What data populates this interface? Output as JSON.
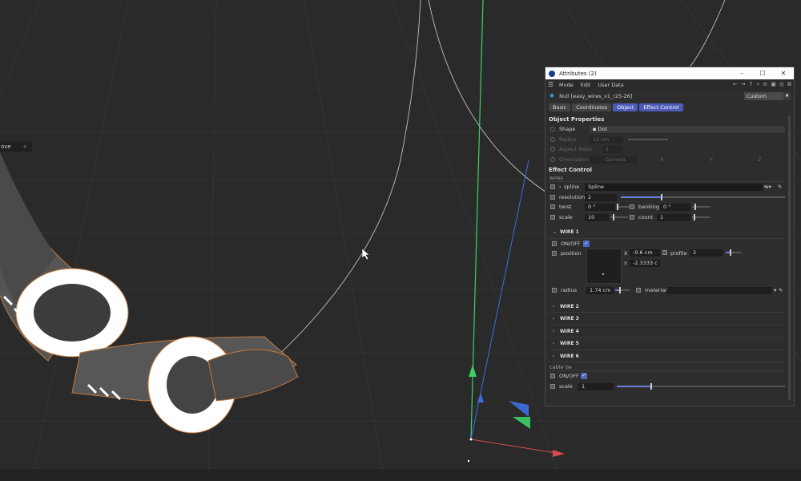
{
  "viewport": {
    "tab_label": "ove",
    "tab_plus": "+"
  },
  "window": {
    "title": "Attributes (2)",
    "controls": {
      "minimize": "–",
      "maximize": "☐",
      "close": "✕"
    }
  },
  "menu": {
    "items": [
      "Mode",
      "Edit",
      "User Data"
    ]
  },
  "object": {
    "name": "Null [easy_wires_v1_r25-26]",
    "mode": "Custom"
  },
  "tabs": [
    {
      "label": "Basic",
      "active": false
    },
    {
      "label": "Coordinates",
      "active": false
    },
    {
      "label": "Object",
      "active": true
    },
    {
      "label": "Effect Control",
      "active": true
    }
  ],
  "object_props": {
    "title": "Object Properties",
    "shape_label": "Shape",
    "shape_value": "Dot",
    "radius_label": "Radius",
    "radius_value": "10 cm",
    "aspect_label": "Aspect Ratio",
    "aspect_value": "1",
    "orientation_label": "Orientation",
    "orientation_value": "Camera",
    "axes": [
      "X",
      "Y",
      "Z"
    ]
  },
  "effect": {
    "title": "Effect Control",
    "group": "wires",
    "spline_label": "spline",
    "spline_value": "Spline",
    "resolution_label": "resolution",
    "resolution_value": "2",
    "twist_label": "twist",
    "twist_value": "0 °",
    "banking_label": "banking",
    "banking_value": "0 °",
    "scale_label": "scale",
    "scale_value": "10",
    "count_label": "count",
    "count_value": "1"
  },
  "wire1": {
    "title": "WIRE 1",
    "onoff_label": "ON/OFF",
    "position_label": "position",
    "x_label": "X",
    "x_value": "-0.6 cm",
    "y_label": "Y",
    "y_value": "-2.3333 c",
    "profile_label": "profile",
    "profile_value": "2",
    "radius_label": "radius",
    "radius_value": "1.74 cm",
    "material_label": "material",
    "material_value": ""
  },
  "wires_collapsed": [
    "WIRE 2",
    "WIRE 3",
    "WIRE 4",
    "WIRE 5",
    "WIRE 6"
  ],
  "cable_tie": {
    "group": "cable tie",
    "onoff_label": "ON/OFF",
    "scale_label": "scale",
    "scale_value": "1"
  },
  "colors": {
    "accent": "#4c5bb8",
    "axis_y": "#3ecf6a",
    "axis_x": "#d94a4a",
    "axis_z": "#3b6fe0"
  }
}
